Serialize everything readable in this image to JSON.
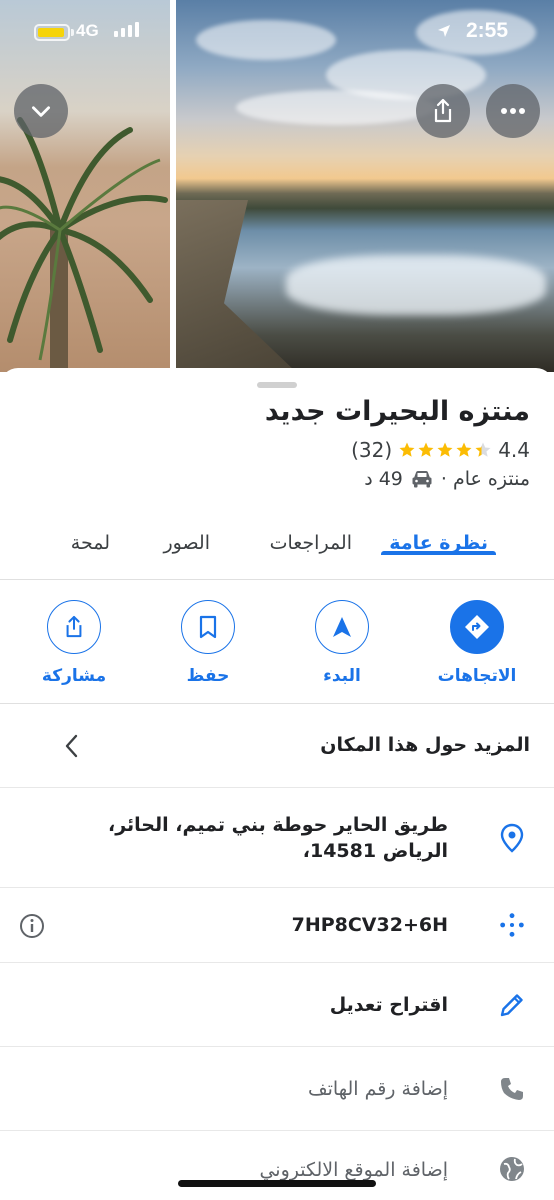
{
  "status_bar": {
    "network": "4G",
    "time": "2:55",
    "battery_color": "#f6d40a"
  },
  "header_buttons": {
    "collapse_icon": "chevron-down-icon",
    "share_icon": "share-icon",
    "more_icon": "more-horizontal-icon"
  },
  "place": {
    "name": "منتزه البحيرات جديد",
    "rating": "4.4",
    "stars": 4.4,
    "review_count": "(32)",
    "category": "منتزه عام ·",
    "drive_time": "49 د"
  },
  "tabs": [
    {
      "label": "نظرة عامة",
      "active": true
    },
    {
      "label": "المراجعات",
      "active": false
    },
    {
      "label": "الصور",
      "active": false
    },
    {
      "label": "لمحة",
      "active": false
    }
  ],
  "actions": {
    "directions": "الاتجاهات",
    "start": "البدء",
    "save": "حفظ",
    "share": "مشاركة"
  },
  "rows": {
    "more_about": "المزيد حول هذا المكان",
    "address_line1": "طريق الحاير حوطة بني تميم، الحائر،",
    "address_line2": "الرياض 14581،",
    "plus_code": "7HP8CV32+6H",
    "suggest_edit": "اقتراح تعديل",
    "add_phone": "إضافة رقم الهاتف",
    "add_website": "إضافة الموقع الالكتروني"
  },
  "colors": {
    "accent": "#1a73e8",
    "star": "#fbbc04"
  }
}
